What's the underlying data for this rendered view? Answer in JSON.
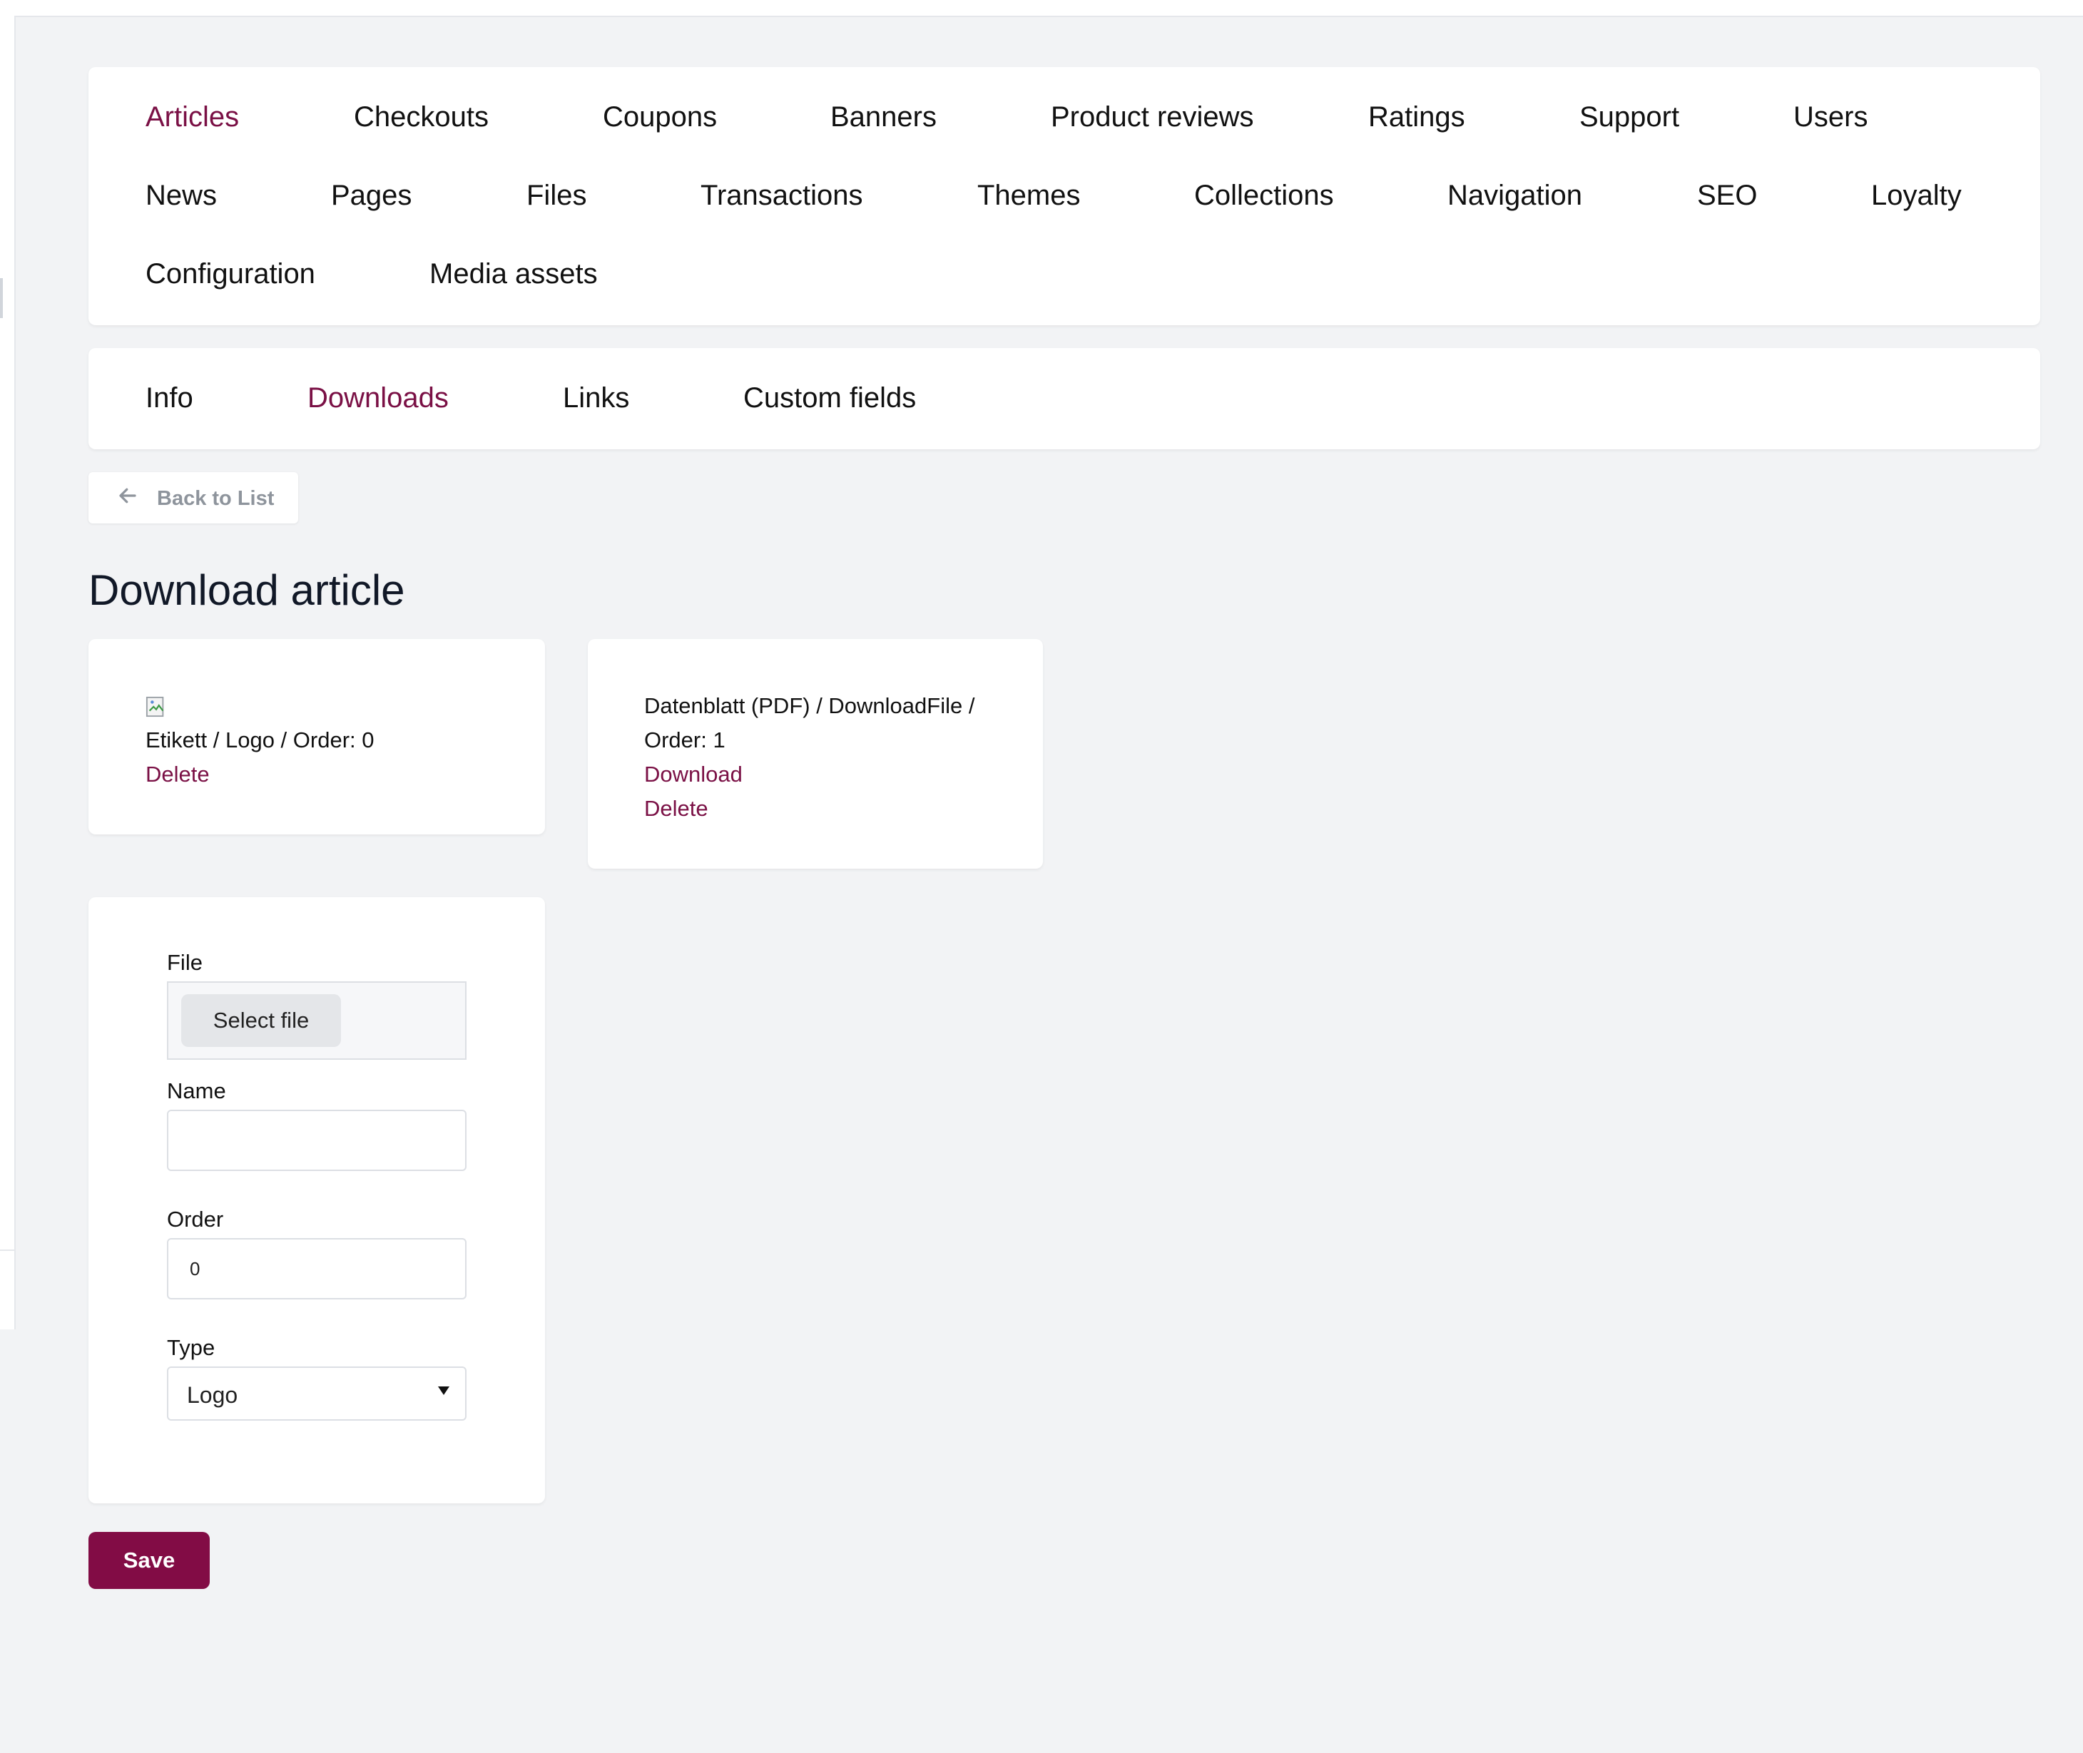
{
  "colors": {
    "accent": "#7a1045",
    "save_button": "#820c45",
    "background": "#f2f3f5"
  },
  "main_nav": {
    "items": [
      {
        "label": "Articles",
        "active": true
      },
      {
        "label": "Checkouts"
      },
      {
        "label": "Coupons"
      },
      {
        "label": "Banners"
      },
      {
        "label": "Product reviews"
      },
      {
        "label": "Ratings"
      },
      {
        "label": "Support"
      },
      {
        "label": "Users"
      },
      {
        "label": "News"
      },
      {
        "label": "Pages"
      },
      {
        "label": "Files"
      },
      {
        "label": "Transactions"
      },
      {
        "label": "Themes"
      },
      {
        "label": "Collections"
      },
      {
        "label": "Navigation"
      },
      {
        "label": "SEO"
      },
      {
        "label": "Loyalty"
      },
      {
        "label": "Configuration"
      },
      {
        "label": "Media assets"
      }
    ]
  },
  "sub_nav": {
    "items": [
      {
        "label": "Info"
      },
      {
        "label": "Downloads",
        "active": true
      },
      {
        "label": "Links"
      },
      {
        "label": "Custom fields"
      }
    ]
  },
  "back_button": {
    "label": "Back to List",
    "icon": "arrow-left-icon"
  },
  "page_title": "Download article",
  "downloads": [
    {
      "icon": "broken-image-icon",
      "description": "Etikett / Logo / Order: 0",
      "delete_label": "Delete"
    },
    {
      "description_line1": "Datenblatt (PDF) / DownloadFile /",
      "description_line2": "Order: 1",
      "download_label": "Download",
      "delete_label": "Delete"
    }
  ],
  "form": {
    "file_label": "File",
    "file_button": "Select file",
    "name_label": "Name",
    "name_value": "",
    "order_label": "Order",
    "order_value": "0",
    "type_label": "Type",
    "type_value": "Logo"
  },
  "save_button": "Save"
}
